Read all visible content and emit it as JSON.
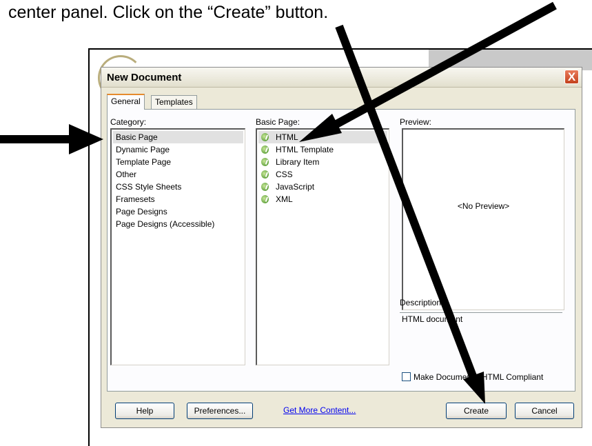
{
  "instruction": "center panel.  Click on the “Create” button.",
  "dialog": {
    "title": "New Document",
    "close_label": "X",
    "tabs": [
      {
        "label": "General",
        "active": true
      },
      {
        "label": "Templates",
        "active": false
      }
    ],
    "category": {
      "label": "Category:",
      "selected": "Basic Page",
      "items": [
        "Basic Page",
        "Dynamic Page",
        "Template Page",
        "Other",
        "CSS Style Sheets",
        "Framesets",
        "Page Designs",
        "Page Designs (Accessible)"
      ]
    },
    "basic_page": {
      "label": "Basic Page:",
      "selected": "HTML",
      "items": [
        "HTML",
        "HTML Template",
        "Library Item",
        "CSS",
        "JavaScript",
        "XML"
      ],
      "item_icon": "page-icon"
    },
    "preview": {
      "label": "Preview:",
      "placeholder": "<No Preview>"
    },
    "description": {
      "label": "Description:",
      "text": "HTML document"
    },
    "xhtml_checkbox": {
      "label": "Make Document XHTML Compliant",
      "checked": false
    },
    "buttons": {
      "help": "Help",
      "preferences": "Preferences...",
      "get_more": "Get More Content...",
      "create": "Create",
      "cancel": "Cancel"
    }
  },
  "annotation_color": "#000000"
}
